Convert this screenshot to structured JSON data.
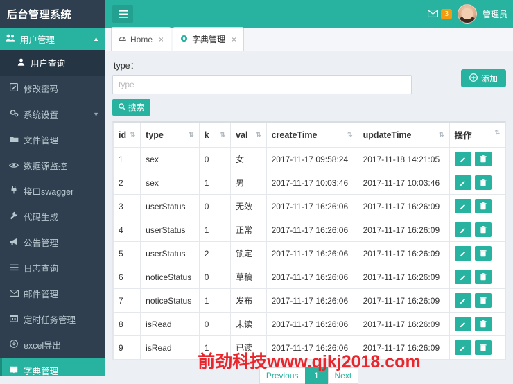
{
  "header": {
    "brand": "后台管理系统",
    "menu_toggle_icon": "hamburger-icon",
    "mail_icon": "envelope-icon",
    "mail_badge": "3",
    "user_label": "管理员"
  },
  "sidebar": {
    "header": {
      "label": "用户管理",
      "icon": "users-icon",
      "caret": "▲"
    },
    "items": [
      {
        "label": "用户查询",
        "icon": "user-icon",
        "sub": true,
        "active": false,
        "caret": ""
      },
      {
        "label": "修改密码",
        "icon": "edit-icon",
        "sub": false,
        "active": false,
        "caret": ""
      },
      {
        "label": "系统设置",
        "icon": "cogs-icon",
        "sub": false,
        "active": false,
        "caret": "▼"
      },
      {
        "label": "文件管理",
        "icon": "folder-icon",
        "sub": false,
        "active": false,
        "caret": ""
      },
      {
        "label": "数据源监控",
        "icon": "eye-icon",
        "sub": false,
        "active": false,
        "caret": ""
      },
      {
        "label": "接口swagger",
        "icon": "plug-icon",
        "sub": false,
        "active": false,
        "caret": ""
      },
      {
        "label": "代码生成",
        "icon": "wrench-icon",
        "sub": false,
        "active": false,
        "caret": ""
      },
      {
        "label": "公告管理",
        "icon": "bullhorn-icon",
        "sub": false,
        "active": false,
        "caret": ""
      },
      {
        "label": "日志查询",
        "icon": "list-icon",
        "sub": false,
        "active": false,
        "caret": ""
      },
      {
        "label": "邮件管理",
        "icon": "mail-icon",
        "sub": false,
        "active": false,
        "caret": ""
      },
      {
        "label": "定时任务管理",
        "icon": "clock-icon",
        "sub": false,
        "active": false,
        "caret": ""
      },
      {
        "label": "excel导出",
        "icon": "download-icon",
        "sub": false,
        "active": false,
        "caret": ""
      },
      {
        "label": "字典管理",
        "icon": "book-icon",
        "sub": false,
        "active": true,
        "caret": ""
      }
    ]
  },
  "tabs": [
    {
      "label": "Home",
      "icon": "dashboard-icon",
      "close": "×",
      "active": false
    },
    {
      "label": "字典管理",
      "icon": "gear-icon",
      "close": "×",
      "active": true
    }
  ],
  "search": {
    "label": "type：",
    "placeholder": "type",
    "value": "",
    "button_label": "搜索",
    "button_icon": "search-icon",
    "add_label": "添加",
    "add_icon": "plus-circle-icon"
  },
  "table": {
    "columns": [
      {
        "label": "id",
        "sort": "⇅"
      },
      {
        "label": "type",
        "sort": "⇅"
      },
      {
        "label": "k",
        "sort": "⇅"
      },
      {
        "label": "val",
        "sort": "⇅"
      },
      {
        "label": "createTime",
        "sort": "⇅"
      },
      {
        "label": "updateTime",
        "sort": "⇅"
      },
      {
        "label": "操作",
        "sort": "⇅"
      }
    ],
    "rows": [
      {
        "id": "1",
        "type": "sex",
        "k": "0",
        "val": "女",
        "createTime": "2017-11-17 09:58:24",
        "updateTime": "2017-11-18 14:21:05"
      },
      {
        "id": "2",
        "type": "sex",
        "k": "1",
        "val": "男",
        "createTime": "2017-11-17 10:03:46",
        "updateTime": "2017-11-17 10:03:46"
      },
      {
        "id": "3",
        "type": "userStatus",
        "k": "0",
        "val": "无效",
        "createTime": "2017-11-17 16:26:06",
        "updateTime": "2017-11-17 16:26:09"
      },
      {
        "id": "4",
        "type": "userStatus",
        "k": "1",
        "val": "正常",
        "createTime": "2017-11-17 16:26:06",
        "updateTime": "2017-11-17 16:26:09"
      },
      {
        "id": "5",
        "type": "userStatus",
        "k": "2",
        "val": "锁定",
        "createTime": "2017-11-17 16:26:06",
        "updateTime": "2017-11-17 16:26:09"
      },
      {
        "id": "6",
        "type": "noticeStatus",
        "k": "0",
        "val": "草稿",
        "createTime": "2017-11-17 16:26:06",
        "updateTime": "2017-11-17 16:26:09"
      },
      {
        "id": "7",
        "type": "noticeStatus",
        "k": "1",
        "val": "发布",
        "createTime": "2017-11-17 16:26:06",
        "updateTime": "2017-11-17 16:26:09"
      },
      {
        "id": "8",
        "type": "isRead",
        "k": "0",
        "val": "未读",
        "createTime": "2017-11-17 16:26:06",
        "updateTime": "2017-11-17 16:26:09"
      },
      {
        "id": "9",
        "type": "isRead",
        "k": "1",
        "val": "已读",
        "createTime": "2017-11-17 16:26:06",
        "updateTime": "2017-11-17 16:26:09"
      }
    ],
    "row_actions": {
      "edit_icon": "pencil-icon",
      "delete_icon": "trash-icon"
    }
  },
  "pagination": {
    "previous": "Previous",
    "pages": [
      "1"
    ],
    "next": "Next",
    "current": "1"
  },
  "watermark": "前劲科技www.qjkj2018.com",
  "colors": {
    "accent": "#28b3a0",
    "sidebar": "#2f3f4f",
    "badge": "#f39c12",
    "watermark": "#e8262c"
  }
}
